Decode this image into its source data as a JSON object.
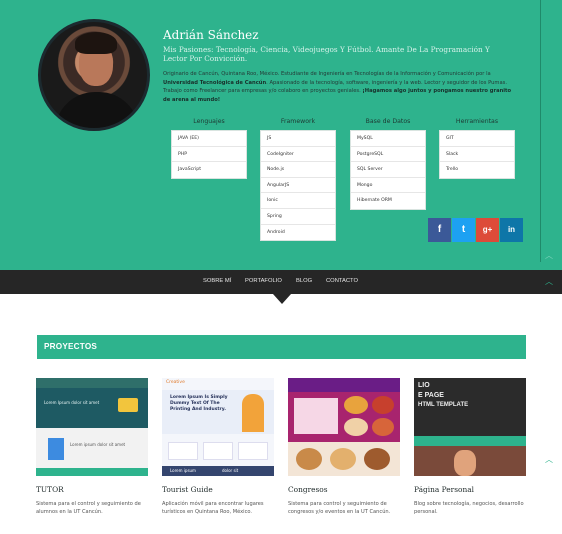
{
  "profile": {
    "name": "Adrián Sánchez",
    "passions": "Mis Pasiones: Tecnología, Ciencia, Videojuegos Y Fútbol. Amante De La Programación Y Lector Por Convicción.",
    "bio_part1": "Originario de Cancún, Quintana Roo, México. Estudiante de Ingeniería en Tecnologías de la Información y Comunicación por la ",
    "bio_bold1": "Universidad Tecnológica de Cancún",
    "bio_part2": ". Apasionado de la tecnología, software, ingeniería y la web. Lector y seguidor de los Pumas. Trabajo como Freelancer para empresas y/o colaboro en proyectos geniales. ",
    "bio_bold2": "¡Hagamos algo juntos y pongamos nuestro granito de arena al mundo!"
  },
  "skills": [
    {
      "title": "Lenguajes",
      "items": [
        "JAVA (EE)",
        "PHP",
        "JavaScript"
      ]
    },
    {
      "title": "Framework",
      "items": [
        "JS",
        "CodeIgniter",
        "Node.js",
        "AngularJS",
        "Ionic",
        "Spring",
        "Android"
      ]
    },
    {
      "title": "Base de Datos",
      "items": [
        "MySQL",
        "PostgreSQL",
        "SQL Server",
        "Mongo",
        "Hibernate ORM"
      ]
    },
    {
      "title": "Herramientas",
      "items": [
        "GIT",
        "Slack",
        "Trello"
      ]
    }
  ],
  "social": [
    {
      "icon": "facebook-icon",
      "glyph": "f",
      "color": "#3b5998"
    },
    {
      "icon": "twitter-icon",
      "glyph": "t",
      "color": "#1da1f2"
    },
    {
      "icon": "google-plus-icon",
      "glyph": "g+",
      "color": "#dd4b39"
    },
    {
      "icon": "linkedin-icon",
      "glyph": "in",
      "color": "#0e76a8"
    }
  ],
  "nav": [
    "SOBRE MÍ",
    "PORTAFOLIO",
    "BLOG",
    "CONTACTO"
  ],
  "section_title": "PROYECTOS",
  "projects": [
    {
      "title": "TUTOR",
      "desc": "Sistema para el control y seguimiento de alumnos en la UT Cancún."
    },
    {
      "title": "Tourist Guide",
      "desc": "Aplicación móvil para encontrar lugares turísticos en Quintana Roo, México."
    },
    {
      "title": "Congresos",
      "desc": "Sistema para control y seguimiento de congresos y/o eventos en la UT Cancún."
    },
    {
      "title": "Página Personal",
      "desc": "Blog sobre tecnología, negocios, desarrollo personal."
    }
  ],
  "thumb_text": {
    "tutor_line": "Lorem Ipsum dolor sit amet",
    "tutor_card": "Lorem ipsum dolor sit amet",
    "guide_brand": "Creative",
    "guide_headline": "Lorem Ipsum Is Simply Dummy Text Of The Printing And Industry.",
    "guide_stat1": "Lorem ipsum",
    "guide_stat2": "dolor sit",
    "personal_line1": "LIO",
    "personal_line2": "E PAGE",
    "personal_line3": "HTML TEMPLATE"
  },
  "colors": {
    "accent": "#2eb38d",
    "nav": "#262626"
  }
}
